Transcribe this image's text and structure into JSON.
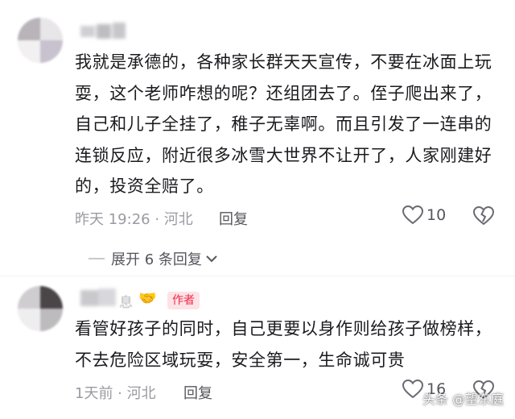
{
  "comments": [
    {
      "text": "我就是承德的，各种家长群天天宣传，不要在冰面上玩耍，这个老师咋想的呢？还组团去了。侄子爬出来了，自己和儿子全挂了，稚子无辜啊。而且引发了一连串的连锁反应，附近很多冰雪大世界不让开了，人家刚建好的，投资全赔了。",
      "time": "昨天 19:26 · 河北",
      "reply_label": "回复",
      "likes": "10",
      "expand_label": "展开 6 条回复"
    },
    {
      "name_partial": "息",
      "badge_emoji": "🤝",
      "author_badge": "作者",
      "text": "看管好孩子的同时，自己更要以身作则给孩子做榜样，不去危险区域玩耍，安全第一，生命诚可贵",
      "time": "1天前 · 河北",
      "reply_label": "回复",
      "likes": "16"
    }
  ],
  "watermark": "头条 @望东庭",
  "colors": {
    "text": "#1b1b1f",
    "meta": "#9a9aa3",
    "badge_bg": "#fde2e6",
    "badge_text": "#ee2a4b"
  }
}
